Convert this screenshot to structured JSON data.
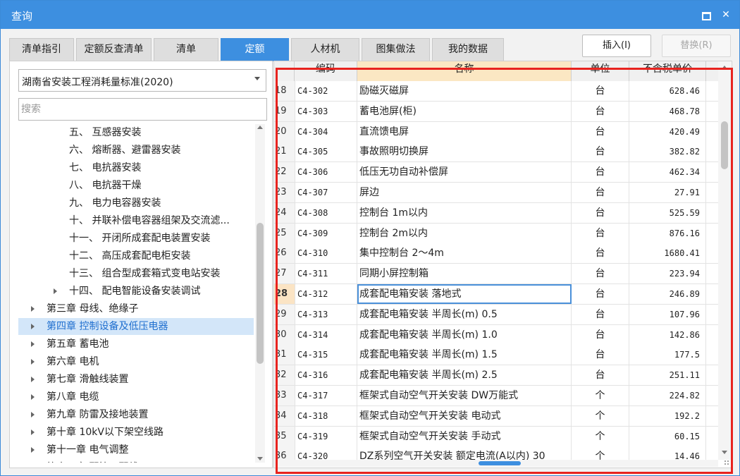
{
  "window": {
    "title": "查询",
    "maximize_icon": "maximize-icon",
    "close_label": "✕"
  },
  "tabs": [
    {
      "label": "清单指引",
      "active": false
    },
    {
      "label": "定额反查清单",
      "active": false
    },
    {
      "label": "清单",
      "active": false
    },
    {
      "label": "定额",
      "active": true
    },
    {
      "label": "人材机",
      "active": false
    },
    {
      "label": "图集做法",
      "active": false
    },
    {
      "label": "我的数据",
      "active": false
    }
  ],
  "actions": {
    "insert_label": "插入(I)",
    "replace_label": "替换(R)"
  },
  "left": {
    "standard_select": {
      "value": "湖南省安装工程消耗量标准(2020)"
    },
    "search": {
      "placeholder": "搜索",
      "value": ""
    },
    "tree": [
      {
        "label": "五、 互感器安装",
        "level": 2,
        "expandable": false,
        "selected": false
      },
      {
        "label": "六、 熔断器、避雷器安装",
        "level": 2,
        "expandable": false,
        "selected": false
      },
      {
        "label": "七、 电抗器安装",
        "level": 2,
        "expandable": false,
        "selected": false
      },
      {
        "label": "八、 电抗器干燥",
        "level": 2,
        "expandable": false,
        "selected": false
      },
      {
        "label": "九、 电力电容器安装",
        "level": 2,
        "expandable": false,
        "selected": false
      },
      {
        "label": "十、 并联补偿电容器组架及交流滤...",
        "level": 2,
        "expandable": false,
        "selected": false
      },
      {
        "label": "十一、 开闭所成套配电装置安装",
        "level": 2,
        "expandable": false,
        "selected": false
      },
      {
        "label": "十二、 高压成套配电柜安装",
        "level": 2,
        "expandable": false,
        "selected": false
      },
      {
        "label": "十三、 组合型成套箱式变电站安装",
        "level": 2,
        "expandable": false,
        "selected": false
      },
      {
        "label": "十四、 配电智能设备安装调试",
        "level": 2,
        "expandable": true,
        "selected": false
      },
      {
        "label": "第三章 母线、绝缘子",
        "level": 1,
        "expandable": true,
        "selected": false
      },
      {
        "label": "第四章 控制设备及低压电器",
        "level": 1,
        "expandable": true,
        "selected": true
      },
      {
        "label": "第五章 蓄电池",
        "level": 1,
        "expandable": true,
        "selected": false
      },
      {
        "label": "第六章 电机",
        "level": 1,
        "expandable": true,
        "selected": false
      },
      {
        "label": "第七章 滑触线装置",
        "level": 1,
        "expandable": true,
        "selected": false
      },
      {
        "label": "第八章 电缆",
        "level": 1,
        "expandable": true,
        "selected": false
      },
      {
        "label": "第九章 防雷及接地装置",
        "level": 1,
        "expandable": true,
        "selected": false
      },
      {
        "label": "第十章 10kV以下架空线路",
        "level": 1,
        "expandable": true,
        "selected": false
      },
      {
        "label": "第十一章 电气调整",
        "level": 1,
        "expandable": true,
        "selected": false
      },
      {
        "label": "第十二章 配管、配线",
        "level": 1,
        "expandable": true,
        "selected": false
      }
    ]
  },
  "grid": {
    "columns": {
      "code": "编码",
      "name": "名称",
      "unit": "单位",
      "price": "不含税单价"
    },
    "rows": [
      {
        "no": "18",
        "code": "C4-302",
        "name": "励磁灭磁屏",
        "unit": "台",
        "price": "628.46"
      },
      {
        "no": "19",
        "code": "C4-303",
        "name": "蓄电池屏(柜)",
        "unit": "台",
        "price": "468.78"
      },
      {
        "no": "20",
        "code": "C4-304",
        "name": "直流馈电屏",
        "unit": "台",
        "price": "420.49"
      },
      {
        "no": "21",
        "code": "C4-305",
        "name": "事故照明切换屏",
        "unit": "台",
        "price": "382.82"
      },
      {
        "no": "22",
        "code": "C4-306",
        "name": "低压无功自动补偿屏",
        "unit": "台",
        "price": "462.34"
      },
      {
        "no": "23",
        "code": "C4-307",
        "name": "屏边",
        "unit": "台",
        "price": "27.91"
      },
      {
        "no": "24",
        "code": "C4-308",
        "name": "控制台 1m以内",
        "unit": "台",
        "price": "525.59"
      },
      {
        "no": "25",
        "code": "C4-309",
        "name": "控制台 2m以内",
        "unit": "台",
        "price": "876.16"
      },
      {
        "no": "26",
        "code": "C4-310",
        "name": "集中控制台 2～4m",
        "unit": "台",
        "price": "1680.41"
      },
      {
        "no": "27",
        "code": "C4-311",
        "name": "同期小屏控制箱",
        "unit": "台",
        "price": "223.94"
      },
      {
        "no": "28",
        "code": "C4-312",
        "name": "成套配电箱安装 落地式",
        "unit": "台",
        "price": "246.89",
        "current": true
      },
      {
        "no": "29",
        "code": "C4-313",
        "name": "成套配电箱安装 半周长(m) 0.5",
        "unit": "台",
        "price": "107.96"
      },
      {
        "no": "30",
        "code": "C4-314",
        "name": "成套配电箱安装 半周长(m) 1.0",
        "unit": "台",
        "price": "142.86"
      },
      {
        "no": "31",
        "code": "C4-315",
        "name": "成套配电箱安装 半周长(m) 1.5",
        "unit": "台",
        "price": "177.5"
      },
      {
        "no": "32",
        "code": "C4-316",
        "name": "成套配电箱安装 半周长(m) 2.5",
        "unit": "台",
        "price": "251.11"
      },
      {
        "no": "33",
        "code": "C4-317",
        "name": "框架式自动空气开关安装 DW万能式",
        "unit": "个",
        "price": "224.82"
      },
      {
        "no": "34",
        "code": "C4-318",
        "name": "框架式自动空气开关安装 电动式",
        "unit": "个",
        "price": "192.2"
      },
      {
        "no": "35",
        "code": "C4-319",
        "name": "框架式自动空气开关安装 手动式",
        "unit": "个",
        "price": "60.15"
      },
      {
        "no": "36",
        "code": "C4-320",
        "name": "DZ系列空气开关安装 额定电流(A以内) 30",
        "unit": "个",
        "price": "14.46"
      }
    ]
  },
  "colors": {
    "accent": "#3d8fe0",
    "selected_row": "#d3e6f9",
    "header_mark": "#fbe7c3",
    "highlight_box": "#e8231f"
  }
}
